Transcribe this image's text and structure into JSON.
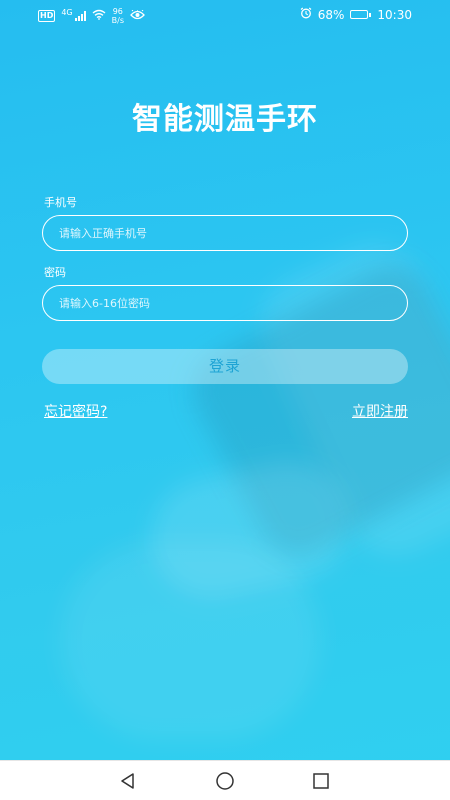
{
  "status_bar": {
    "hd": "HD",
    "network": "4G",
    "speed_value": "96",
    "speed_unit": "B/s",
    "battery_percent": "68%",
    "battery_level": 0.68,
    "time": "10:30",
    "icons": [
      "signal-icon",
      "wifi-icon",
      "eye-icon",
      "alarm-icon",
      "battery-icon"
    ]
  },
  "login": {
    "title": "智能测温手环",
    "phone_label": "手机号",
    "phone_placeholder": "请输入正确手机号",
    "phone_value": "",
    "password_label": "密码",
    "password_placeholder": "请输入6-16位密码",
    "password_value": "",
    "login_button": "登录",
    "forgot_password": "忘记密码?",
    "register": "立即注册"
  },
  "nav_bar": {
    "icons": [
      "back-icon",
      "home-icon",
      "recent-apps-icon"
    ]
  },
  "colors": {
    "background": "#2cc6f1",
    "button_text": "#1ea4d4",
    "text": "#ffffff"
  }
}
